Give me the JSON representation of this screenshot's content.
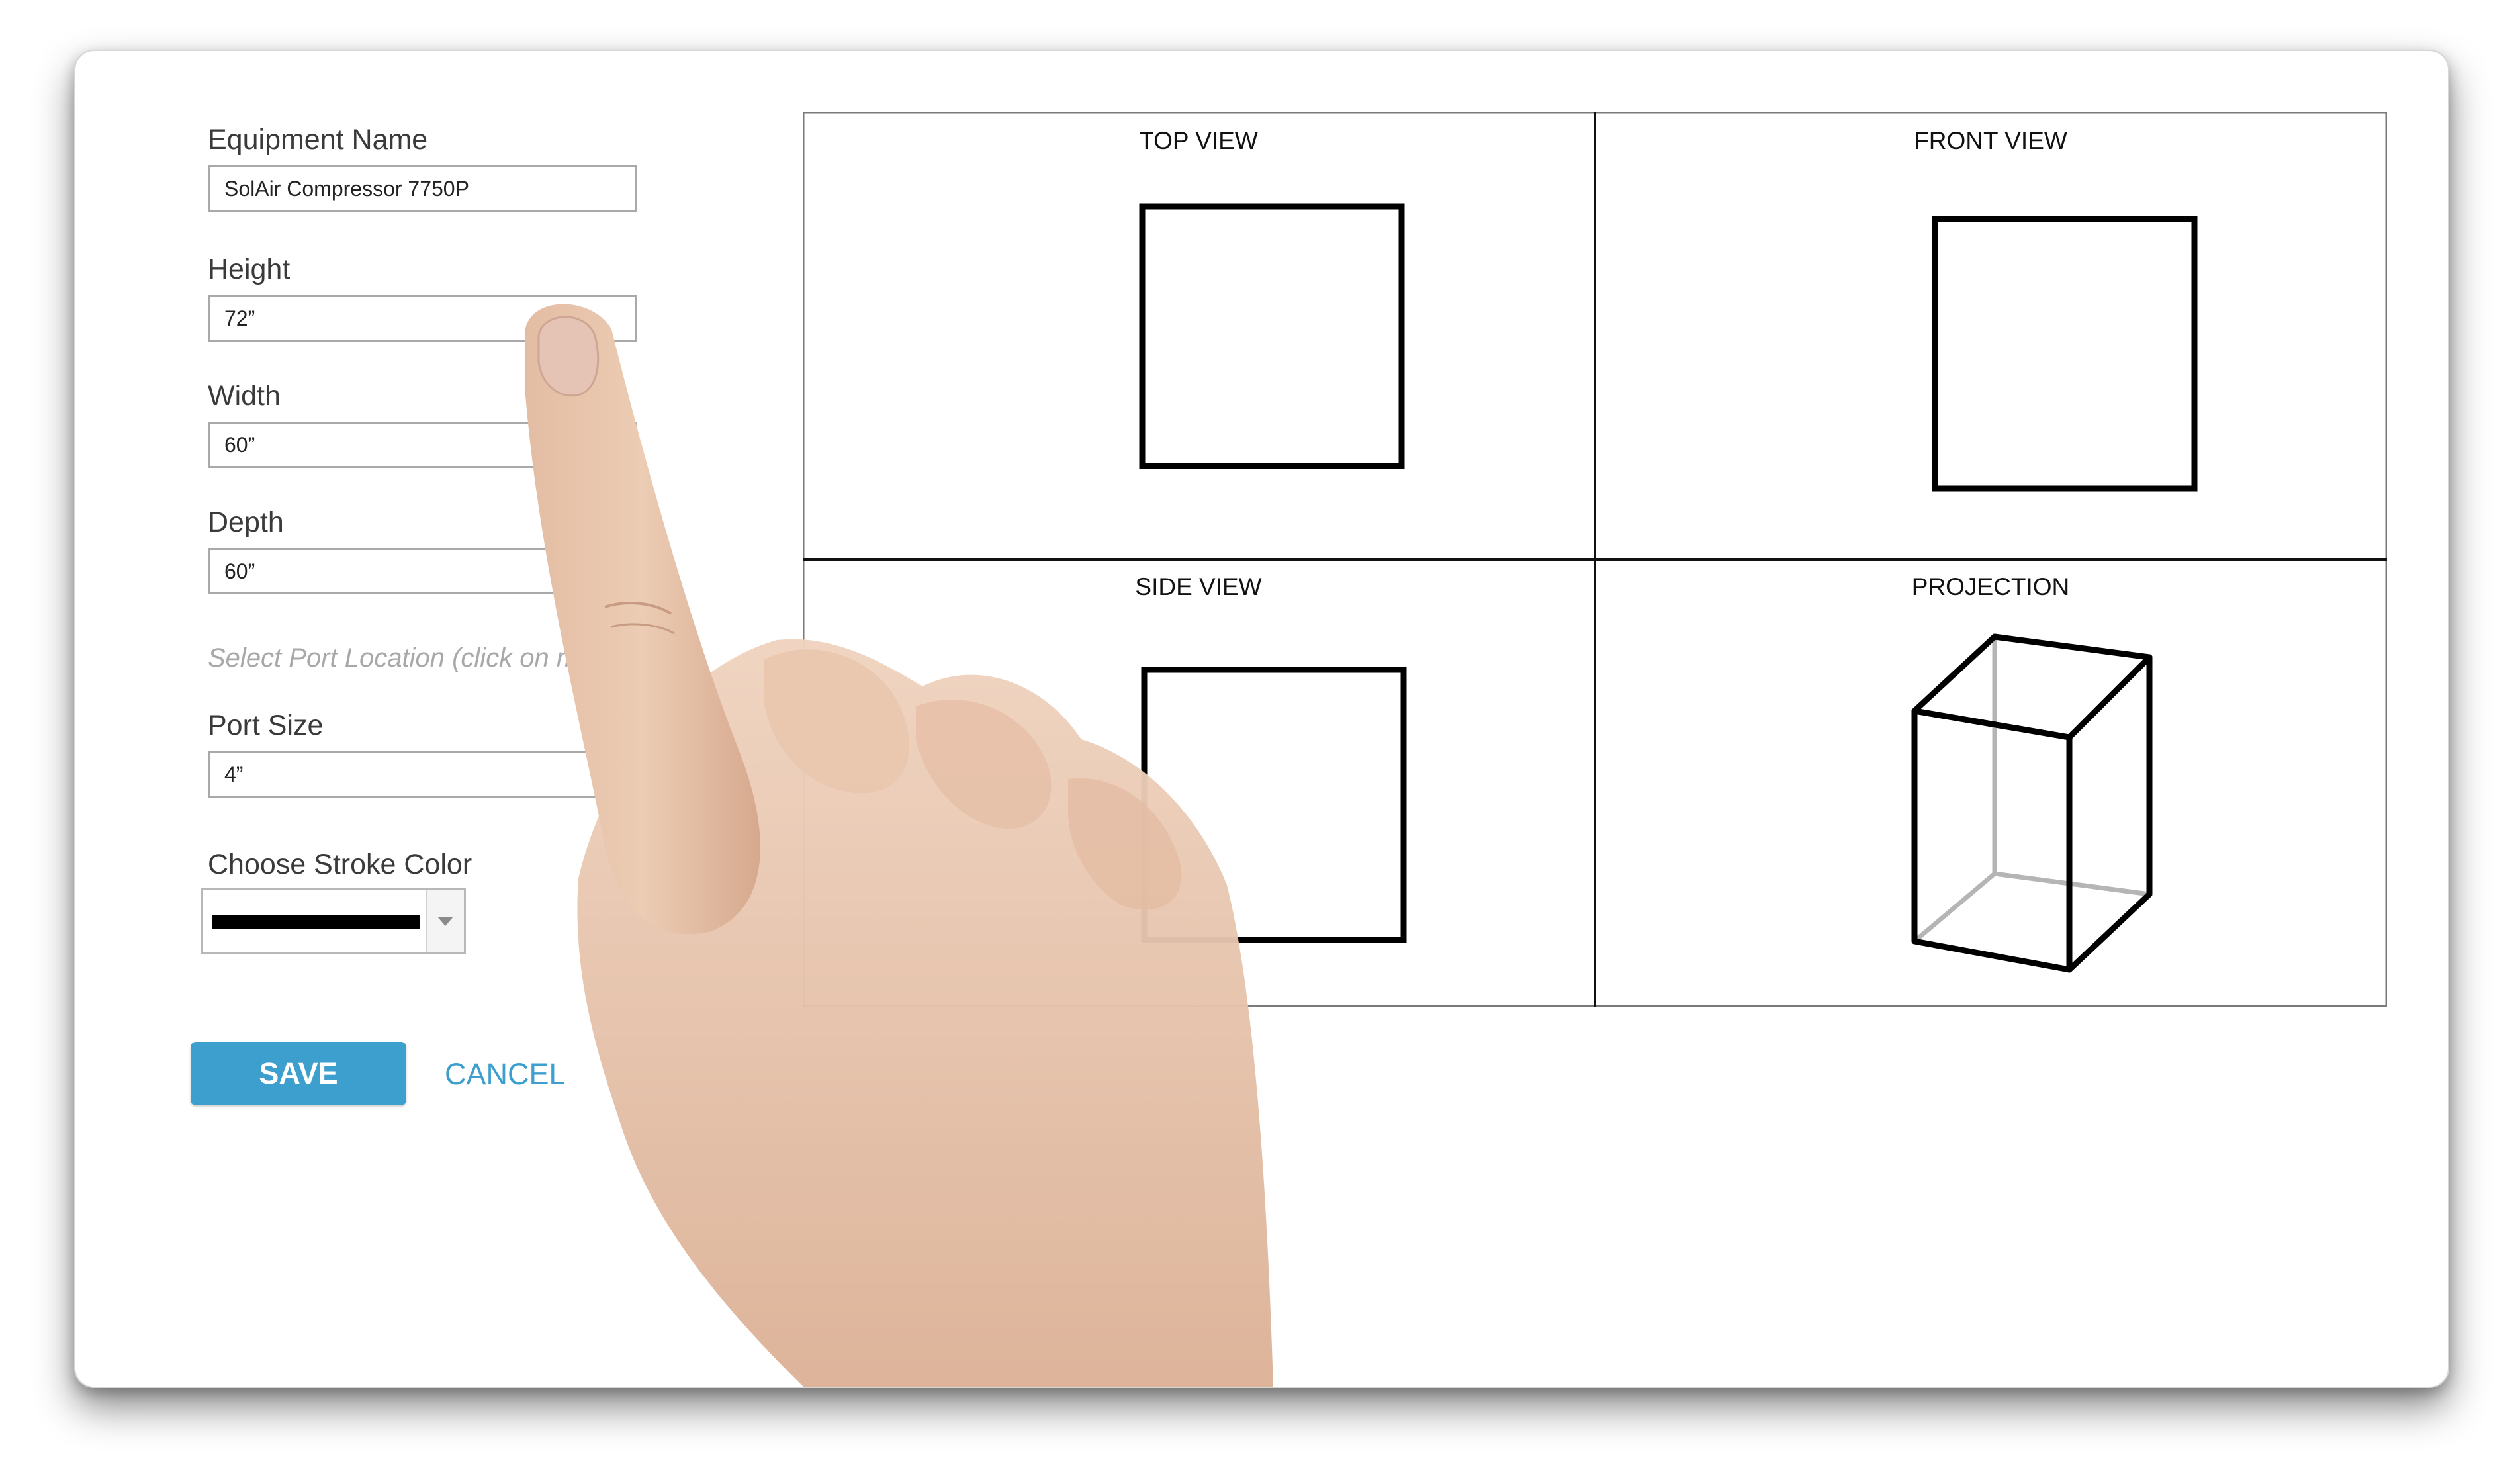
{
  "form": {
    "equipment_name_label": "Equipment Name",
    "equipment_name_value": "SolAir Compressor 7750P",
    "height_label": "Height",
    "height_value": "72”",
    "width_label": "Width",
    "width_value": "60”",
    "depth_label": "Depth",
    "depth_value": "60”",
    "port_location_hint": "Select Port Location (click on model)",
    "port_size_label": "Port Size",
    "port_size_value": "4”",
    "stroke_color_label": "Choose Stroke Color",
    "stroke_color_value": "#000000"
  },
  "actions": {
    "save_label": "SAVE",
    "cancel_label": "CANCEL"
  },
  "views": {
    "top_title": "TOP VIEW",
    "front_title": "FRONT VIEW",
    "side_title": "SIDE VIEW",
    "projection_title": "PROJECTION"
  },
  "colors": {
    "accent": "#3d9fcd",
    "label_text": "#3a3a3a",
    "hint_text": "#a8a8a8",
    "stroke": "#000000"
  },
  "icons": {
    "dropdown": "chevron-down-icon"
  }
}
